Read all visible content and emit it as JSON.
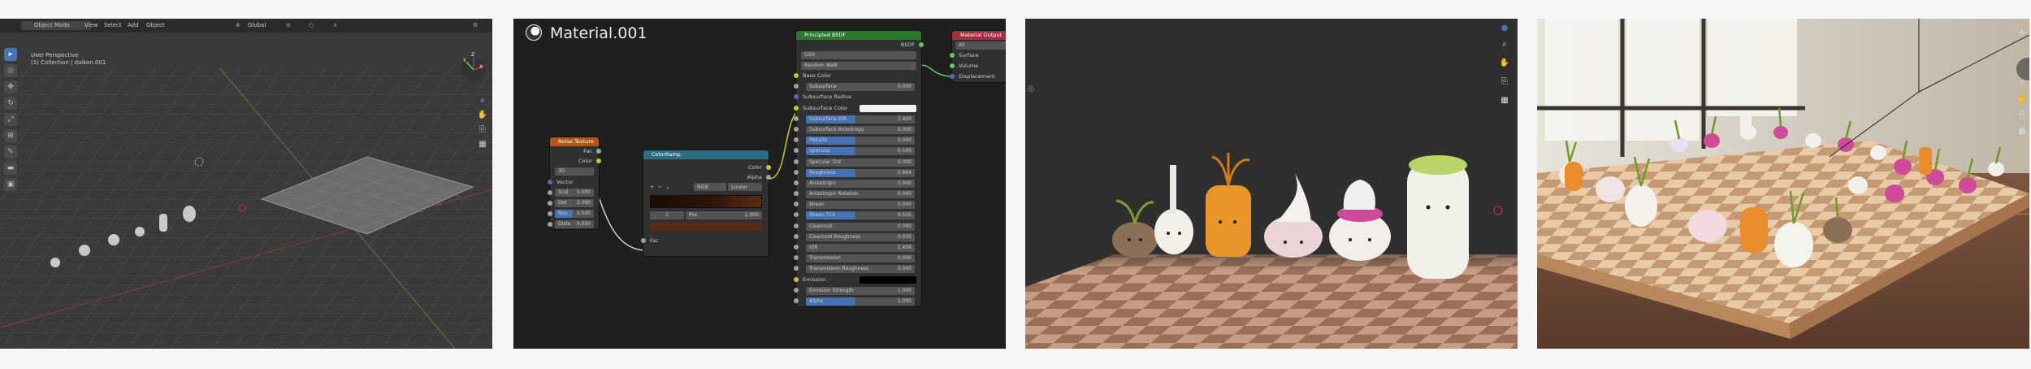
{
  "viewport": {
    "mode": "Object Mode",
    "menu": [
      "View",
      "Select",
      "Add",
      "Object"
    ],
    "transform": "Global",
    "overlay_line1": "User Perspective",
    "overlay_line2": "(1) Collection | daikon.001",
    "toolbar_icons": [
      "select-icon",
      "cursor-icon",
      "move-icon",
      "rotate-icon",
      "scale-icon",
      "transform-icon",
      "annotate-icon",
      "measure-icon",
      "add-cube-icon"
    ],
    "gizmo": {
      "x": "X",
      "y": "Y",
      "z": "Z"
    },
    "nav_icons": [
      "zoom-icon",
      "hand-icon",
      "camera-icon",
      "grid-icon"
    ]
  },
  "material": {
    "title": "Material.001",
    "noise": {
      "header": "Noise Texture",
      "outputs": [
        "Fac",
        "Color"
      ],
      "dim": "3D",
      "vector": "Vector",
      "fields": [
        {
          "label": "Scal",
          "value": "5.000"
        },
        {
          "label": "Det",
          "value": "2.000"
        },
        {
          "label": "Rou",
          "value": "0.500"
        },
        {
          "label": "Disto",
          "value": "0.000"
        }
      ]
    },
    "ramp": {
      "header": "ColorRamp",
      "outputs": [
        "Color",
        "Alpha"
      ],
      "mode": "RGB",
      "interp": "Linear",
      "index": "1",
      "pos_label": "Pos",
      "pos_value": "1.000",
      "input": "Fac"
    },
    "bsdf": {
      "header": "Principled BSDF",
      "output": "BSDF",
      "distribution": "GGX",
      "subsurface_method": "Random Walk",
      "rows": [
        {
          "label": "Base Color",
          "type": "color",
          "socket": "yel"
        },
        {
          "label": "Subsurface",
          "value": "0.000",
          "type": "field",
          "socket": "gray"
        },
        {
          "label": "Subsurface Radius",
          "type": "drop",
          "socket": "pur"
        },
        {
          "label": "Subsurface Color",
          "type": "swatch",
          "socket": "yel"
        },
        {
          "label": "Subsurface IOR",
          "value": "1.400",
          "type": "blue",
          "socket": "gray"
        },
        {
          "label": "Subsurface Anisotropy",
          "value": "0.000",
          "type": "field",
          "socket": "gray"
        },
        {
          "label": "Metallic",
          "value": "0.000",
          "type": "blue",
          "socket": "gray"
        },
        {
          "label": "Specular",
          "value": "0.500",
          "type": "blue",
          "socket": "gray"
        },
        {
          "label": "Specular Tint",
          "value": "0.000",
          "type": "field",
          "socket": "gray"
        },
        {
          "label": "Roughness",
          "value": "0.864",
          "type": "blue",
          "socket": "gray"
        },
        {
          "label": "Anisotropic",
          "value": "0.000",
          "type": "field",
          "socket": "gray"
        },
        {
          "label": "Anisotropic Rotation",
          "value": "0.000",
          "type": "field",
          "socket": "gray"
        },
        {
          "label": "Sheen",
          "value": "0.000",
          "type": "field",
          "socket": "gray"
        },
        {
          "label": "Sheen Tint",
          "value": "0.500",
          "type": "blue",
          "socket": "gray"
        },
        {
          "label": "Clearcoat",
          "value": "0.000",
          "type": "field",
          "socket": "gray"
        },
        {
          "label": "Clearcoat Roughness",
          "value": "0.030",
          "type": "field",
          "socket": "gray"
        },
        {
          "label": "IOR",
          "value": "1.450",
          "type": "field",
          "socket": "gray"
        },
        {
          "label": "Transmission",
          "value": "0.000",
          "type": "field",
          "socket": "gray"
        },
        {
          "label": "Transmission Roughness",
          "value": "0.000",
          "type": "field",
          "socket": "gray"
        },
        {
          "label": "Emission",
          "type": "black",
          "socket": "yel"
        },
        {
          "label": "Emission Strength",
          "value": "1.000",
          "type": "field",
          "socket": "gray"
        },
        {
          "label": "Alpha",
          "value": "1.000",
          "type": "blue",
          "socket": "gray"
        }
      ]
    },
    "output": {
      "header": "Material Output",
      "target": "All",
      "inputs": [
        "Surface",
        "Volume",
        "Displacement"
      ]
    }
  },
  "colors": {
    "noise_header": "#b25617",
    "ramp_header": "#2c6d83",
    "bsdf_header": "#2b7a2b",
    "output_header": "#a33040",
    "active_tool": "#4772b3"
  }
}
